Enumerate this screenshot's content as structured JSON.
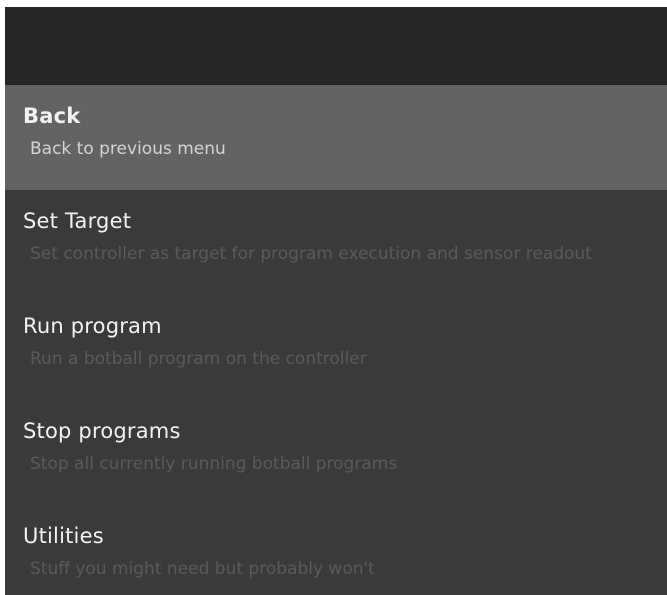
{
  "menu": {
    "items": [
      {
        "title": "Back",
        "description": "Back to previous menu",
        "selected": true
      },
      {
        "title": "Set Target",
        "description": "Set controller as target for program execution and sensor readout",
        "selected": false
      },
      {
        "title": "Run program",
        "description": "Run a botball program on the controller",
        "selected": false
      },
      {
        "title": "Stop programs",
        "description": "Stop all currently running botball programs",
        "selected": false
      },
      {
        "title": "Utilities",
        "description": "Stuff you might need but probably won't",
        "selected": false
      }
    ]
  },
  "colors": {
    "header_bg": "#262626",
    "list_bg": "#3a3a3a",
    "selected_bg": "#636363",
    "title_text": "#f2f2f2",
    "desc_text": "#5a5a5a",
    "selected_desc_text": "#d4d4d4"
  }
}
